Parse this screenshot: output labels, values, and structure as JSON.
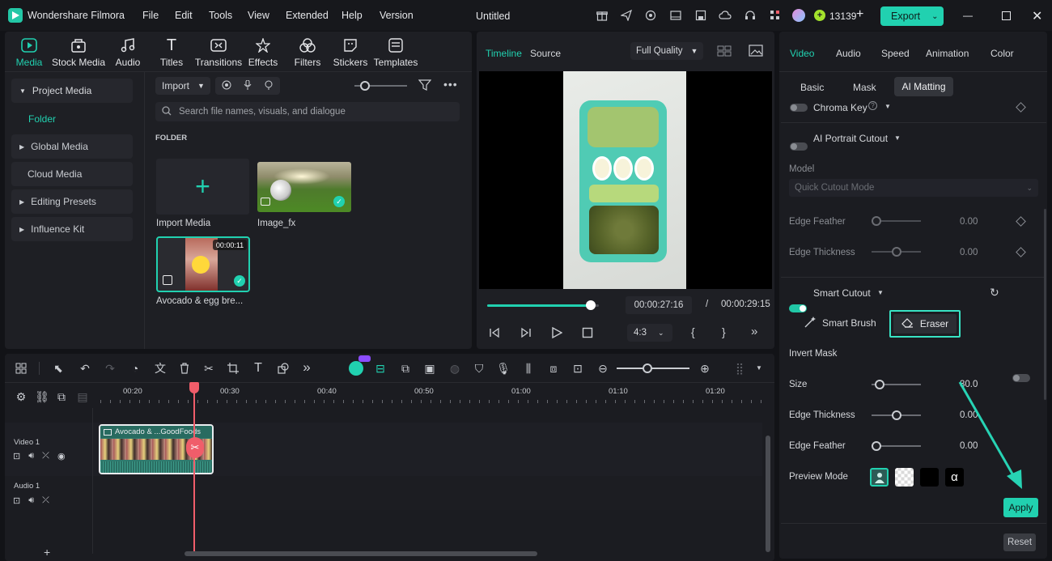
{
  "app": {
    "name": "Wondershare Filmora",
    "doc_title": "Untitled",
    "credits": "13139",
    "export_label": "Export"
  },
  "menu": [
    "File",
    "Edit",
    "Tools",
    "View",
    "Extended",
    "Help",
    "Version"
  ],
  "toolbar": [
    "Media",
    "Stock Media",
    "Audio",
    "Titles",
    "Transitions",
    "Effects",
    "Filters",
    "Stickers",
    "Templates"
  ],
  "sidebar": {
    "items": [
      "Project Media",
      "Folder",
      "Global Media",
      "Cloud Media",
      "Editing Presets",
      "Influence Kit"
    ]
  },
  "media": {
    "import_label": "Import",
    "search_placeholder": "Search file names, visuals, and dialogue",
    "folder_label": "FOLDER",
    "items": [
      {
        "name": "Import Media"
      },
      {
        "name": "Image_fx"
      },
      {
        "name": "Avocado & egg bre...",
        "duration": "00:00:11"
      }
    ]
  },
  "preview": {
    "tab_timeline": "Timeline",
    "tab_source": "Source",
    "quality": "Full Quality",
    "current_time": "00:00:27:16",
    "separator": "/",
    "total_time": "00:00:29:15",
    "aspect": "4:3",
    "progress": 0.93
  },
  "inspector": {
    "tabs": [
      "Video",
      "Audio",
      "Speed",
      "Animation",
      "Color"
    ],
    "subtabs": [
      "Basic",
      "Mask",
      "AI Matting"
    ],
    "chroma_key": "Chroma Key",
    "portrait_cutout": "AI Portrait Cutout",
    "model_label": "Model",
    "model_value": "Quick Cutout Mode",
    "edge_feather_label": "Edge Feather",
    "edge_feather_value": "0.00",
    "edge_thickness_label": "Edge Thickness",
    "edge_thickness_value": "0.00",
    "smart_cutout": "Smart Cutout",
    "smart_brush": "Smart Brush",
    "eraser": "Eraser",
    "invert_mask": "Invert Mask",
    "size_label": "Size",
    "size_value": "30.0",
    "edge_thickness2_value": "0.00",
    "edge_feather2_value": "0.00",
    "preview_mode": "Preview Mode",
    "apply_label": "Apply",
    "reset_label": "Reset"
  },
  "timeline": {
    "ticks": [
      "00:20",
      "00:30",
      "00:40",
      "00:50",
      "01:00",
      "01:10",
      "01:20"
    ],
    "video_track": "Video 1",
    "audio_track": "Audio 1",
    "clip_label": "Avocado & ...GoodFoods"
  },
  "colors": {
    "accent": "#21d1b0",
    "bg": "#121317",
    "panel": "#1e1f24",
    "playhead": "#f05d6a"
  }
}
